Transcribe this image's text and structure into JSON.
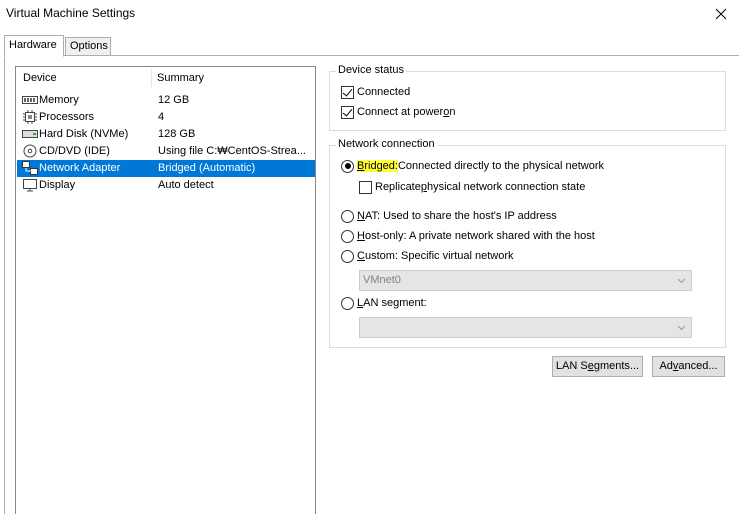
{
  "window": {
    "title": "Virtual Machine Settings",
    "close_label": "×"
  },
  "tabs": [
    {
      "label": "Hardware",
      "active": true
    },
    {
      "label": "Options",
      "active": false
    }
  ],
  "device_list": {
    "columns": [
      "Device",
      "Summary"
    ],
    "rows": [
      {
        "icon": "memory-icon",
        "name": "Memory",
        "summary": "12 GB",
        "selected": false
      },
      {
        "icon": "processor-icon",
        "name": "Processors",
        "summary": "4",
        "selected": false
      },
      {
        "icon": "hard-disk-icon",
        "name": "Hard Disk (NVMe)",
        "summary": "128 GB",
        "selected": false
      },
      {
        "icon": "cd-dvd-icon",
        "name": "CD/DVD (IDE)",
        "summary": "Using file C:₩CentOS-Strea...",
        "selected": false
      },
      {
        "icon": "network-adapter-icon",
        "name": "Network Adapter",
        "summary": "Bridged (Automatic)",
        "selected": true
      },
      {
        "icon": "display-icon",
        "name": "Display",
        "summary": "Auto detect",
        "selected": false
      }
    ]
  },
  "device_status": {
    "title": "Device status",
    "connected_label": "Connected",
    "connected_checked": true,
    "power_on_label_pre": "Connect at power ",
    "power_on_label_u": "o",
    "power_on_label_post": "n",
    "power_on_checked": true
  },
  "network_connection": {
    "title": "Network connection",
    "bridged_label_u": "B",
    "bridged_label_rest": "ridged:",
    "bridged_desc": " Connected directly to the physical network",
    "bridged_checked": true,
    "replicate_pre": "Replicate ",
    "replicate_u": "p",
    "replicate_post": "hysical network connection state",
    "replicate_checked": false,
    "nat_u": "N",
    "nat_rest": "AT: Used to share the host's IP address",
    "hostonly_u": "H",
    "hostonly_rest": "ost-only: A private network shared with the host",
    "custom_u": "C",
    "custom_rest": "ustom: Specific virtual network",
    "vmnet_value": "VMnet0",
    "lan_u": "L",
    "lan_rest": "AN segment:",
    "lan_value": ""
  },
  "buttons": {
    "lan_segments_pre": "LAN S",
    "lan_segments_u": "e",
    "lan_segments_post": "gments...",
    "advanced_pre": "Ad",
    "advanced_u": "v",
    "advanced_post": "anced..."
  },
  "colors": {
    "selection": "#0078d7",
    "highlight": "#ffff33"
  }
}
